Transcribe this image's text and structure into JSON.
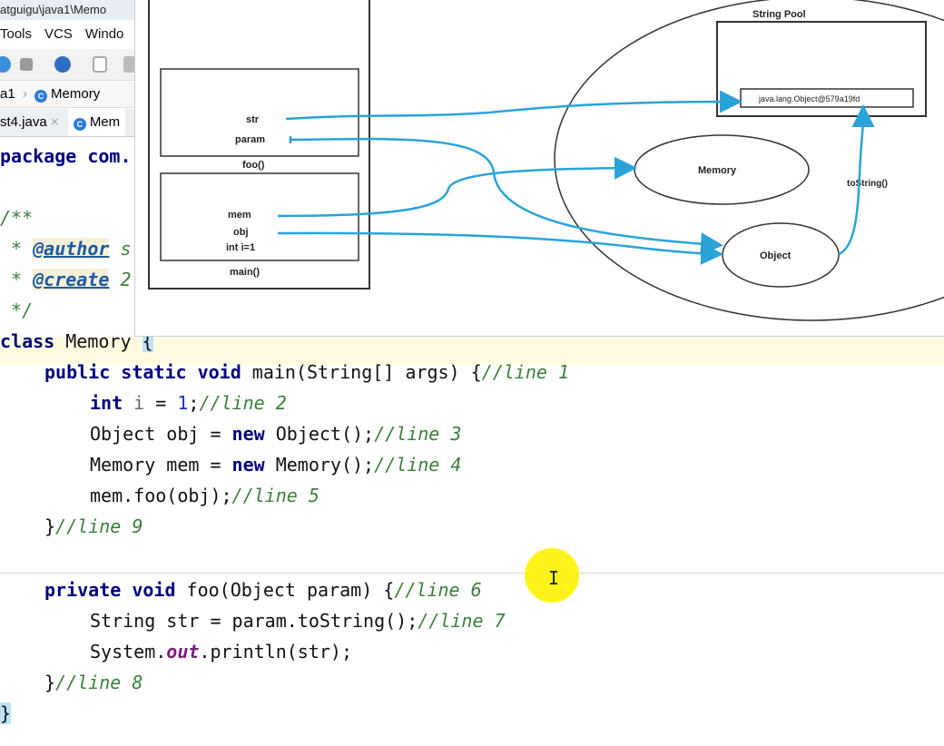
{
  "window": {
    "title": "atguigu\\java1\\Memo"
  },
  "menu": {
    "tools": "Tools",
    "vcs": "VCS",
    "window": "Windo"
  },
  "breadcrumb": {
    "module": "a1",
    "class_name": "Memory"
  },
  "tabs": {
    "first": "st4.java",
    "close": "×",
    "second": "Mem"
  },
  "code": {
    "l0": "package com.",
    "l1": "/**",
    "l2_star": " * ",
    "l2_tag": "@author",
    "l2_rest": " s",
    "l3_star": " * ",
    "l3_tag": "@create",
    "l3_rest": " 2",
    "l4": " */",
    "l5_kw": "class",
    "l5_name": " Memory ",
    "l5_brace": "{",
    "l6_kw": "public static void",
    "l6_rest": " main(String[] args) {",
    "l6_cm": "//line 1",
    "l7_kw": "int",
    "l7_var": " i",
    "l7_eq": " = ",
    "l7_num": "1",
    "l7_semi": ";",
    "l7_cm": "//line 2",
    "l8_a": "Object obj = ",
    "l8_kw": "new",
    "l8_b": " Object();",
    "l8_cm": "//line 3",
    "l9_a": "Memory mem = ",
    "l9_kw": "new",
    "l9_b": " Memory();",
    "l9_cm": "//line 4",
    "l10_a": "mem.foo(obj);",
    "l10_cm": "//line 5",
    "l11_a": "}",
    "l11_cm": "//line 9",
    "l12_kw": "private void",
    "l12_rest": " foo(Object param) {",
    "l12_cm": "//line 6",
    "l13_a": "String str = param.toString();",
    "l13_cm": "//line 7",
    "l14_a": "System.",
    "l14_fld": "out",
    "l14_b": ".println(str);",
    "l15_a": "}",
    "l15_cm": "//line 8",
    "l16": "}"
  },
  "diagram": {
    "string_pool": "String Pool",
    "pool_value": "java.lang.Object@579a19fd",
    "str": "str",
    "param": "param",
    "foo_frame": "foo()",
    "mem": "mem",
    "obj": "obj",
    "int_i": "int i=1",
    "main_frame": "main()",
    "memory_obj": "Memory",
    "object_obj": "Object",
    "to_string": "toString()"
  },
  "colors": {
    "arrow": "#2aa3d8",
    "keyword": "#000080",
    "comment": "#3b7f3b",
    "highlight": "#bfe2f5"
  }
}
